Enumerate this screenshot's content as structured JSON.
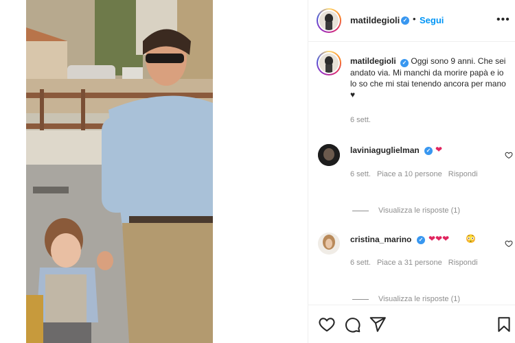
{
  "post": {
    "username": "matildegioli",
    "follow_label": "Segui",
    "dot": "•",
    "more_label": "•••"
  },
  "caption": {
    "username": "matildegioli",
    "text": "Oggi sono 9 anni. Che sei andato via. Mi manchi da morire papà e io lo so che mi stai tenendo ancora per mano ♥",
    "time": "6 sett."
  },
  "comments": [
    {
      "username": "laviniaguglielman",
      "text": "❤",
      "time": "6 sett.",
      "likes": "Piace a 10 persone",
      "reply_label": "Rispondi",
      "view_replies": "Visualizza le risposte (1)"
    },
    {
      "username": "cristina_marino",
      "text": "❤❤❤",
      "emoji_extra": "😳",
      "time": "6 sett.",
      "likes": "Piace a 31 persone",
      "reply_label": "Rispondi",
      "view_replies": "Visualizza le risposte (1)"
    }
  ],
  "actions": [
    "heart-icon",
    "comment-icon",
    "share-icon",
    "bookmark-icon"
  ],
  "colors": {
    "link_blue": "#0095f6",
    "verified_blue": "#3897f0",
    "heart_red": "#e0245e",
    "muted_gray": "#8e8e8e"
  }
}
